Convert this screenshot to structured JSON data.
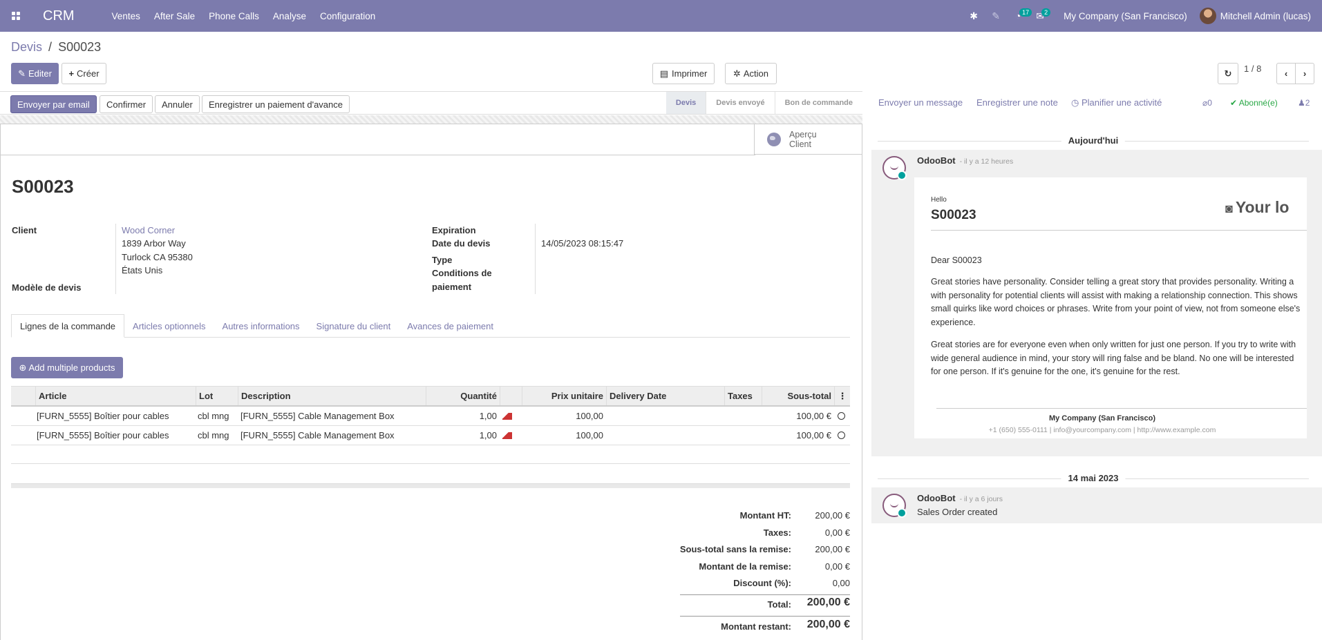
{
  "navbar": {
    "app_name": "CRM",
    "menu": [
      "Ventes",
      "After Sale",
      "Phone Calls",
      "Analyse",
      "Configuration"
    ],
    "activity_count": "17",
    "message_count": "2",
    "company": "My Company (San Francisco)",
    "user": "Mitchell Admin (lucas)"
  },
  "breadcrumb": {
    "parent": "Devis",
    "separator": "/",
    "current": "S00023"
  },
  "control": {
    "edit": "Editer",
    "create": "Créer",
    "print": "Imprimer",
    "action": "Action",
    "pager": "1 / 8"
  },
  "statusbar": {
    "buttons": [
      "Envoyer par email",
      "Confirmer",
      "Annuler",
      "Enregistrer un paiement d'avance"
    ],
    "stages": [
      "Devis",
      "Devis envoyé",
      "Bon de commande"
    ],
    "active_stage": "Devis"
  },
  "sheet": {
    "preview_button": [
      "Aperçu",
      "Client"
    ],
    "title": "S00023",
    "client_label": "Client",
    "client_name": "Wood Corner",
    "client_address": [
      "1839 Arbor Way",
      "Turlock CA 95380",
      "États Unis"
    ],
    "template_label": "Modèle de devis",
    "expiration_label": "Expiration",
    "date_label": "Date du devis",
    "date_value": "14/05/2023 08:15:47",
    "type_label": "Type",
    "conditions_label": [
      "Conditions de",
      "paiement"
    ]
  },
  "tabs": [
    "Lignes de la commande",
    "Articles optionnels",
    "Autres informations",
    "Signature du client",
    "Avances de paiement"
  ],
  "add_button": "Add multiple products",
  "table": {
    "headers": [
      "Article",
      "Lot",
      "Description",
      "Quantité",
      "Prix unitaire",
      "Delivery Date",
      "Taxes",
      "Sous-total"
    ],
    "rows": [
      {
        "article": "[FURN_5555] Boîtier pour cables",
        "lot": "cbl mng",
        "description": "[FURN_5555] Cable Management Box",
        "qty": "1,00",
        "price": "100,00",
        "delivery": "",
        "taxes": "",
        "subtotal": "100,00 €"
      },
      {
        "article": "[FURN_5555] Boîtier pour cables",
        "lot": "cbl mng",
        "description": "[FURN_5555] Cable Management Box",
        "qty": "1,00",
        "price": "100,00",
        "delivery": "",
        "taxes": "",
        "subtotal": "100,00 €"
      }
    ]
  },
  "totals": [
    {
      "label": "Montant HT:",
      "value": "200,00 €"
    },
    {
      "label": "Taxes:",
      "value": "0,00 €"
    },
    {
      "label": "Sous-total sans la remise:",
      "value": "200,00 €"
    },
    {
      "label": "Montant de la remise:",
      "value": "0,00 €"
    },
    {
      "label": "Discount (%):",
      "value": "0,00"
    },
    {
      "label": "Total:",
      "value": "200,00 €"
    },
    {
      "label": "Montant restant:",
      "value": "200,00 €"
    }
  ],
  "chatter": {
    "send_message": "Envoyer un message",
    "log_note": "Enregistrer une note",
    "schedule": "Planifier une activité",
    "attachments": "0",
    "follow": "Abonné(e)",
    "followers": "2",
    "today": "Aujourd'hui",
    "msg1": {
      "author": "OdooBot",
      "when": "- il y a 12 heures",
      "hello": "Hello",
      "title": "S00023",
      "logo": "Your lo",
      "dear": "Dear S00023",
      "para1": [
        "Great stories have personality. Consider telling a great story that provides personality. Writing a",
        "with personality for potential clients will assist with making a relationship connection. This shows",
        "small quirks like word choices or phrases. Write from your point of view, not from someone else's",
        "experience."
      ],
      "para2": [
        "Great stories are for everyone even when only written for just one person. If you try to write with",
        "wide general audience in mind, your story will ring false and be bland. No one will be interested",
        "for one person. If it's genuine for the one, it's genuine for the rest."
      ],
      "footer_company": "My Company (San Francisco)",
      "footer_contact": "+1 (650) 555-0111 | info@yourcompany.com | http://www.example.com"
    },
    "date2": "14 mai 2023",
    "msg2": {
      "author": "OdooBot",
      "when": "- il y a 6 jours",
      "body": "Sales Order created"
    }
  },
  "colors": {
    "brand": "#7c7bad",
    "teal": "#00a09d",
    "follow": "#28a745"
  }
}
